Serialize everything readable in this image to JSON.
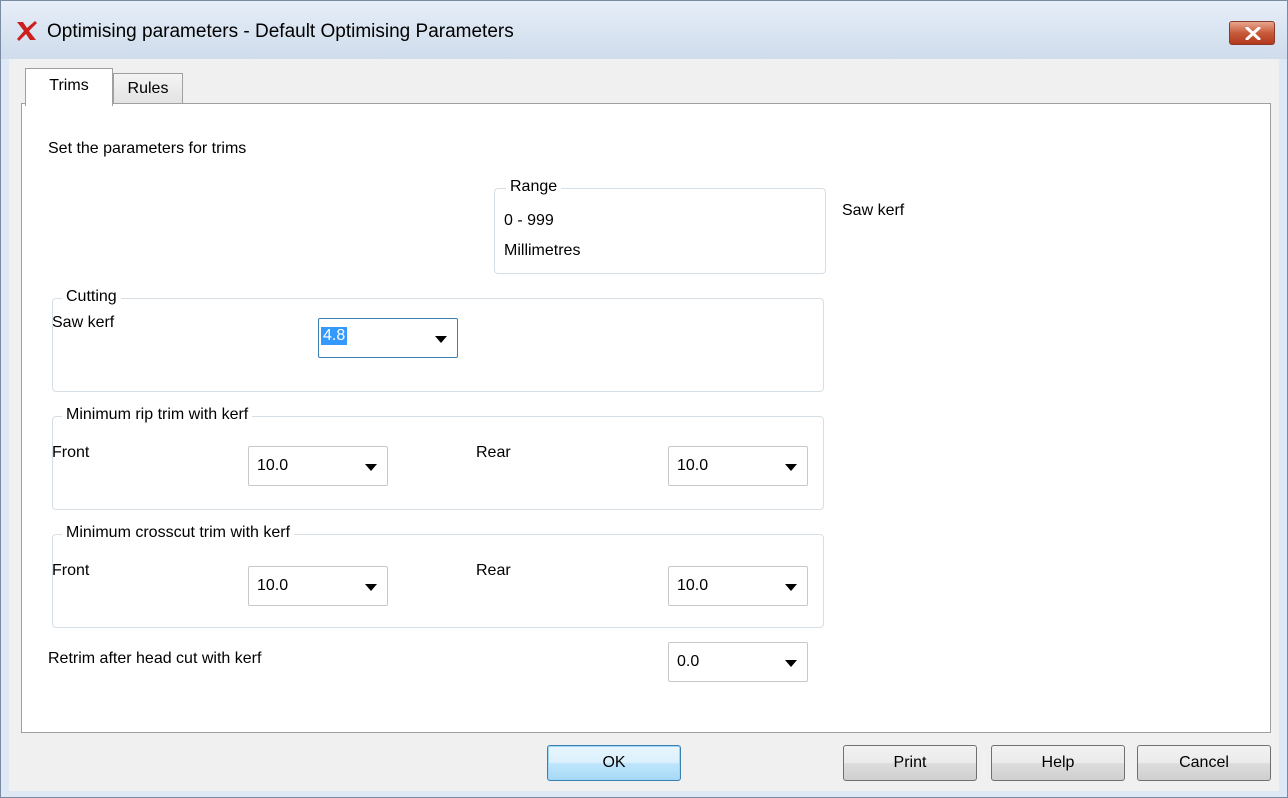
{
  "window": {
    "title": "Optimising parameters - Default Optimising Parameters",
    "accent": "#cc1f1f"
  },
  "tabs": [
    {
      "label": "Trims",
      "active": true
    },
    {
      "label": "Rules",
      "active": false
    }
  ],
  "intro": "Set the parameters for trims",
  "range": {
    "legend": "Range",
    "values": "0 - 999",
    "unit": "Millimetres"
  },
  "illustration": {
    "caption": "Saw kerf"
  },
  "cutting": {
    "legend": "Cutting",
    "saw_kerf_label": "Saw kerf",
    "saw_kerf_value": "4.8"
  },
  "rip_trim": {
    "legend": "Minimum rip trim with kerf",
    "front_label": "Front",
    "front_value": "10.0",
    "rear_label": "Rear",
    "rear_value": "10.0"
  },
  "crosscut_trim": {
    "legend": "Minimum crosscut trim with kerf",
    "front_label": "Front",
    "front_value": "10.0",
    "rear_label": "Rear",
    "rear_value": "10.0"
  },
  "retrim": {
    "label": "Retrim after head cut with kerf",
    "value": "0.0"
  },
  "buttons": {
    "ok": "OK",
    "print": "Print",
    "help": "Help",
    "cancel": "Cancel"
  }
}
